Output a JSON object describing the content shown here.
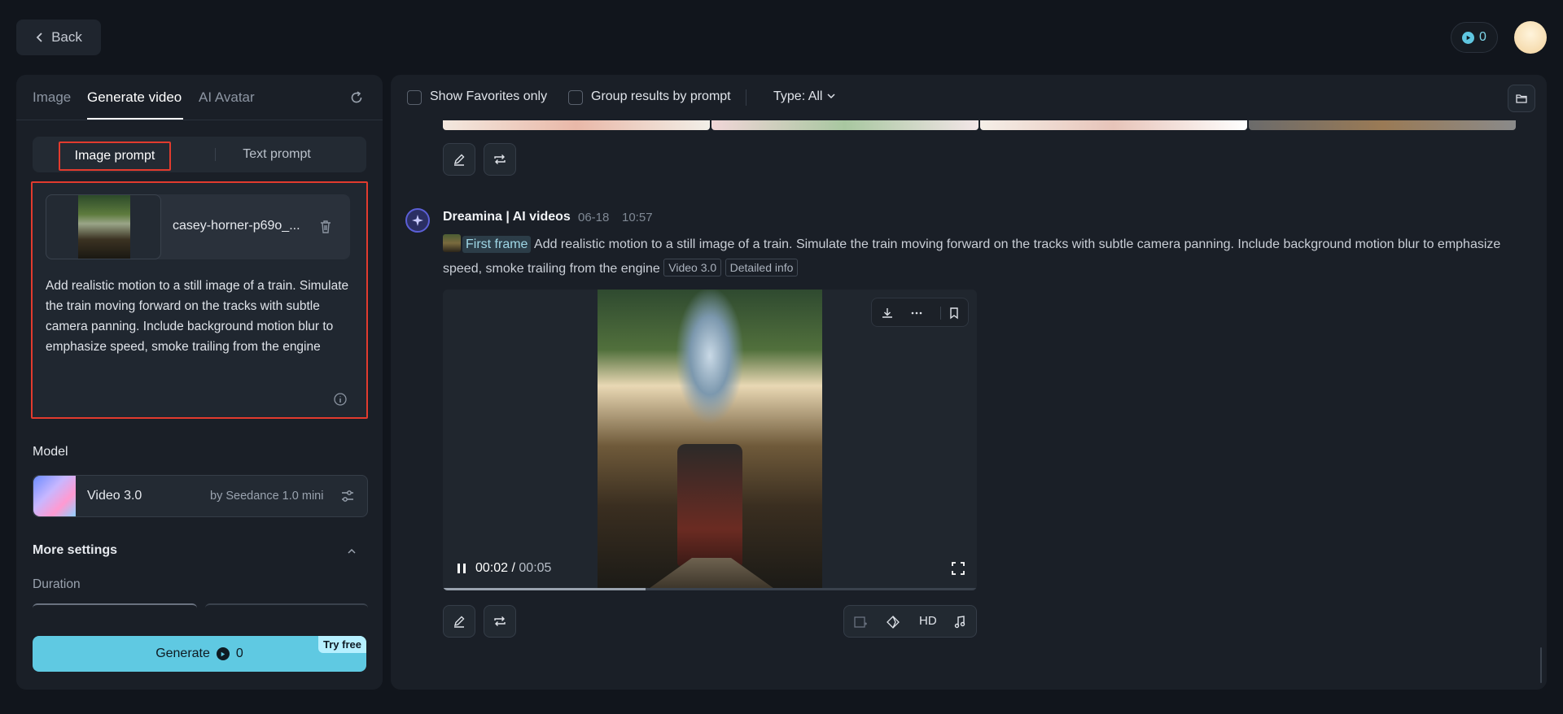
{
  "topbar": {
    "back_label": "Back",
    "credits": "0"
  },
  "left": {
    "tabs": [
      "Image",
      "Generate video",
      "AI Avatar"
    ],
    "active_tab": "Generate video",
    "prompt_mode": {
      "active": "Image prompt",
      "other": "Text prompt"
    },
    "file_name": "casey-horner-p69o_...",
    "prompt_text": "Add realistic motion to a still image of a train. Simulate the train moving forward on the tracks with subtle camera panning. Include background motion blur to emphasize speed, smoke trailing from the engine",
    "model_label": "Model",
    "model": {
      "name": "Video 3.0",
      "by": "by Seedance 1.0 mini"
    },
    "more_settings_label": "More settings",
    "duration_label": "Duration",
    "generate_label": "Generate",
    "generate_cost": "0",
    "try_free": "Try free"
  },
  "right": {
    "filters": {
      "favorites": "Show Favorites only",
      "group": "Group results by prompt",
      "type": "Type: All"
    },
    "message": {
      "title": "Dreamina | AI videos",
      "date": "06-18",
      "time": "10:57",
      "first_frame": "First frame",
      "text": "Add realistic motion to a still image of a train. Simulate the train moving forward on the tracks with subtle camera panning. Include background motion blur to emphasize speed, smoke trailing from the engine",
      "tags": [
        "Video 3.0",
        "Detailed info"
      ]
    },
    "video": {
      "current_time": "00:02",
      "separator": "/",
      "total_time": "00:05",
      "progress": 0.38,
      "hd_label": "HD"
    }
  },
  "colors": {
    "accent_cyan": "#5fc9e2",
    "highlight_red": "#e23b2e",
    "panel_bg": "#1a1f27",
    "page_bg": "#11151c"
  }
}
